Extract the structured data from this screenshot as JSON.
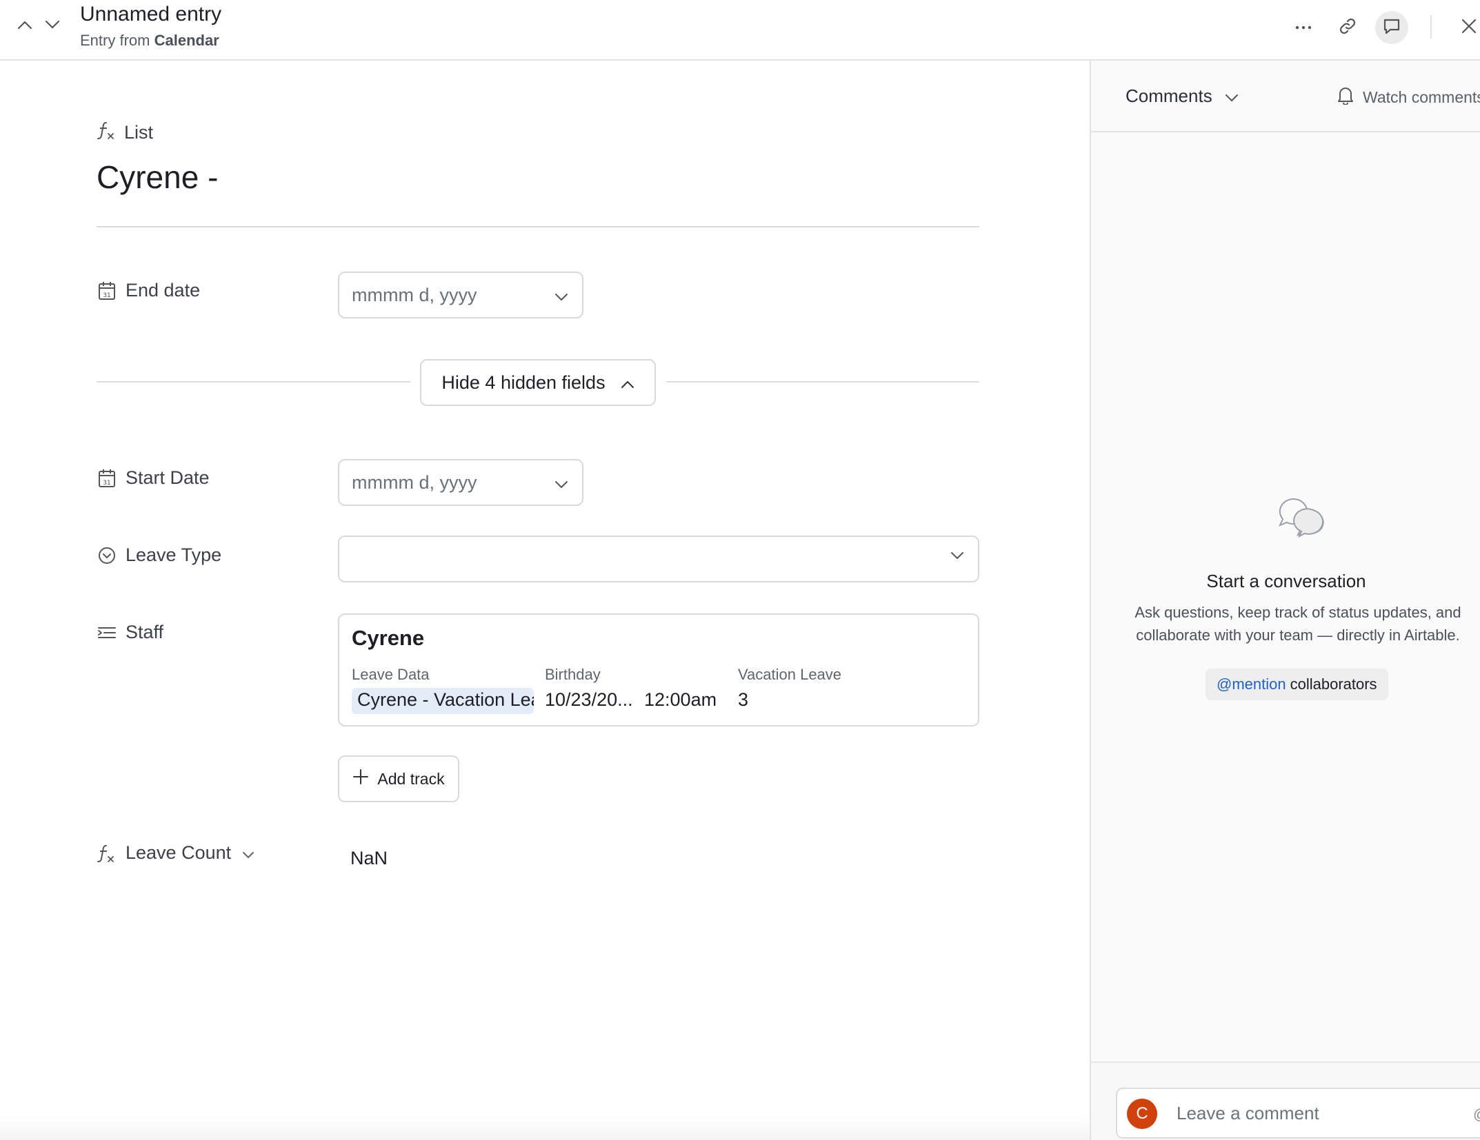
{
  "header": {
    "title": "Unnamed entry",
    "subtitle_prefix": "Entry from",
    "subtitle_source": "Calendar",
    "icons": [
      "chevron-up-icon",
      "chevron-down-icon",
      "more-icon",
      "link-icon",
      "comment-icon",
      "close-icon"
    ]
  },
  "record": {
    "primary_field_label": "List",
    "title": "Cyrene -"
  },
  "fields": {
    "end_date": {
      "label": "End date",
      "placeholder": "mmmm d, yyyy"
    },
    "hidden_toggle": "Hide 4 hidden fields",
    "start_date": {
      "label": "Start Date",
      "placeholder": "mmmm d, yyyy"
    },
    "leave_type": {
      "label": "Leave Type",
      "value": ""
    },
    "staff": {
      "label": "Staff",
      "card": {
        "name": "Cyrene",
        "columns": [
          {
            "header": "Leave Data",
            "value": "Cyrene - Vacation Leave"
          },
          {
            "header": "Birthday",
            "value": "10/23/20...",
            "time": "12:00am"
          },
          {
            "header": "Vacation Leave",
            "value": "3"
          }
        ]
      },
      "add_button": "Add track"
    },
    "leave_count": {
      "label": "Leave Count",
      "value": "NaN"
    }
  },
  "comments": {
    "title": "Comments",
    "watch": "Watch comments",
    "empty_title": "Start a conversation",
    "empty_desc_line1": "Ask questions, keep track of status updates, and",
    "empty_desc_line2": "collaborate with your team — directly in Airtable.",
    "mention_at": "@mention",
    "mention_rest": "collaborators",
    "composer_placeholder": "Leave a comment",
    "avatar_letter": "C",
    "composer_at": "@"
  },
  "colors": {
    "avatar": "#d1410c",
    "mention_link": "#1e63c4",
    "chip_bg": "#e4ecfa"
  }
}
